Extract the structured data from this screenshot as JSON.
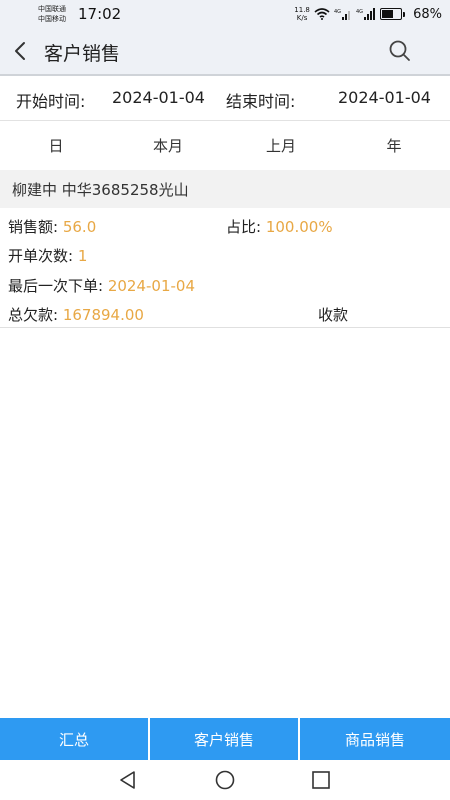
{
  "status_bar": {
    "carrier_1": "中国联通",
    "carrier_2": "中国移动",
    "time": "17:02",
    "net_speed_value": "11.8",
    "net_speed_unit": "K/s",
    "battery_percent": "68%",
    "battery_level": 0.68
  },
  "header": {
    "title": "客户销售",
    "back_icon": "chevron-left-icon",
    "search_icon": "search-icon"
  },
  "date_range": {
    "start_label": "开始时间:",
    "start_value": "2024-01-04",
    "end_label": "结束时间:",
    "end_value": "2024-01-04"
  },
  "period_tabs": [
    "日",
    "本月",
    "上月",
    "年"
  ],
  "customer": {
    "name": "柳建中 中华3685258光山"
  },
  "record": {
    "sales_label": "销售额:",
    "sales_value": "56.0",
    "ratio_label": "占比:",
    "ratio_value": "100.00%",
    "orders_label": "开单次数:",
    "orders_value": "1",
    "last_order_label": "最后一次下单:",
    "last_order_value": "2024-01-04",
    "debt_label": "总欠款:",
    "debt_value": "167894.00",
    "collect_label": "收款"
  },
  "bottom_tabs": [
    "汇总",
    "客户销售",
    "商品销售"
  ],
  "nav": {
    "back": "triangle-back-icon",
    "home": "circle-home-icon",
    "recent": "square-recent-icon"
  },
  "colors": {
    "accent": "#2e9af2",
    "value": "#e8a845",
    "header_bg": "#eef1f6"
  }
}
